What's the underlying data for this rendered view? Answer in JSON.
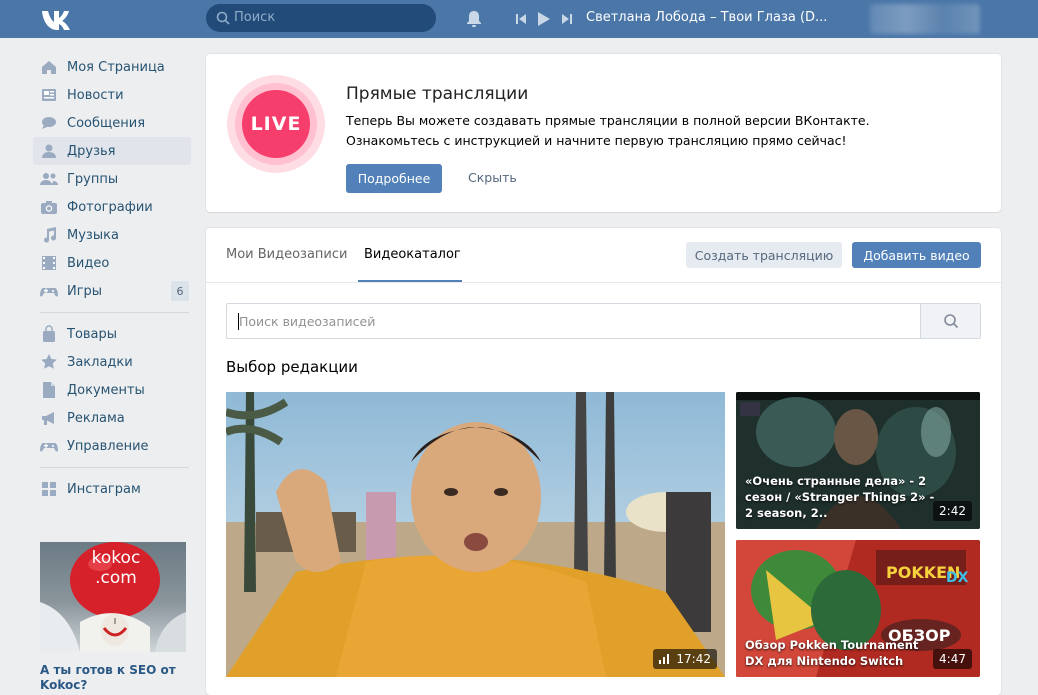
{
  "header": {
    "search_placeholder": "Поиск",
    "now_playing": "Светлана Лобода – Твои Глаза (D..."
  },
  "sidebar": {
    "items": [
      {
        "label": "Моя Страница",
        "icon": "home-icon"
      },
      {
        "label": "Новости",
        "icon": "news-icon"
      },
      {
        "label": "Сообщения",
        "icon": "messages-icon"
      },
      {
        "label": "Друзья",
        "icon": "friend-icon"
      },
      {
        "label": "Группы",
        "icon": "groups-icon"
      },
      {
        "label": "Фотографии",
        "icon": "camera-icon"
      },
      {
        "label": "Музыка",
        "icon": "music-icon"
      },
      {
        "label": "Видео",
        "icon": "video-icon"
      },
      {
        "label": "Игры",
        "icon": "gamepad-icon",
        "badge": "6"
      }
    ],
    "items2": [
      {
        "label": "Товары",
        "icon": "bag-icon"
      },
      {
        "label": "Закладки",
        "icon": "star-icon"
      },
      {
        "label": "Документы",
        "icon": "document-icon"
      },
      {
        "label": "Реклама",
        "icon": "megaphone-icon"
      },
      {
        "label": "Управление",
        "icon": "gamepad-icon"
      }
    ],
    "items3": [
      {
        "label": "Инстаграм",
        "icon": "grid-icon"
      }
    ],
    "ad": {
      "balloon_text": "kokoc .com",
      "title": "А ты готов к SEO от Kokoc?"
    }
  },
  "live": {
    "logo_text": "LIVE",
    "title": "Прямые трансляции",
    "text_line1": "Теперь Вы можете создавать прямые трансляции в полной версии ВКонтакте.",
    "text_line2": "Ознакомьтесь с инструкцией и начните первую трансляцию прямо сейчас!",
    "more_button": "Подробнее",
    "hide_button": "Скрыть"
  },
  "video": {
    "tabs": [
      "Мои Видеозаписи",
      "Видеокаталог"
    ],
    "active_tab": "Видеокаталог",
    "create_stream_button": "Создать трансляцию",
    "add_video_button": "Добавить видео",
    "search_placeholder": "Поиск видеозаписей",
    "section_title": "Выбор редакции",
    "videos": [
      {
        "title": "",
        "duration": "17:42"
      },
      {
        "title": "«Очень странные дела» - 2 сезон / «Stranger Things 2» - 2 season, 2..",
        "duration": "2:42"
      },
      {
        "title": "Обзор Pokken Tournament DX для Nintendo Switch",
        "duration": "4:47"
      }
    ]
  },
  "colors": {
    "header_bg": "#4a76a8",
    "accent": "#5181b8",
    "live_red": "#f53e6b"
  }
}
